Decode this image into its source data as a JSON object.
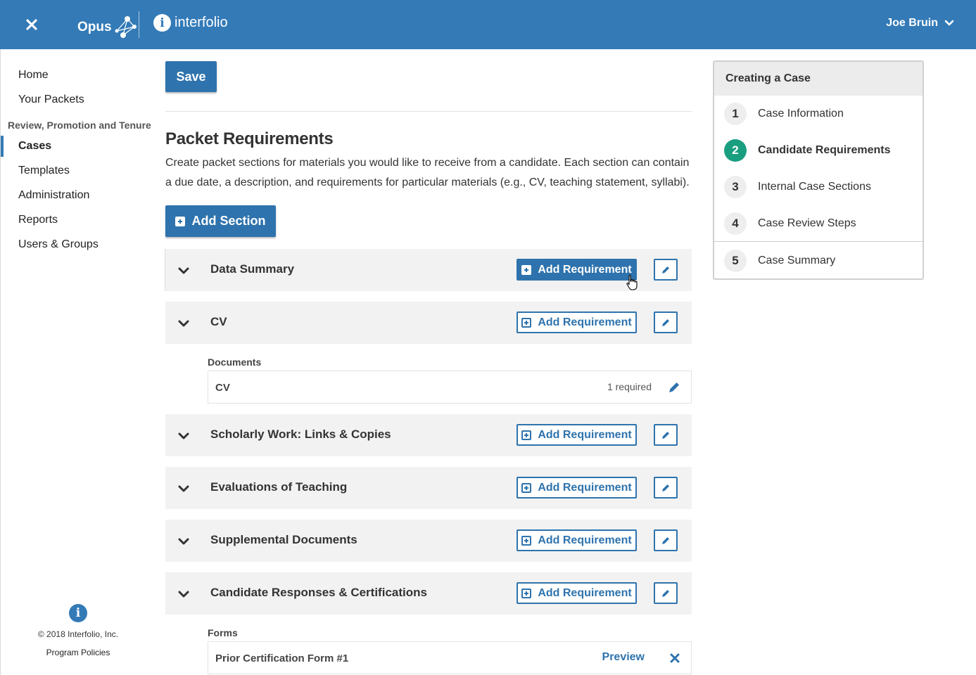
{
  "topbar": {
    "close_icon": "close-icon",
    "opus_label": "Opus",
    "interfolio_label": "interfolio",
    "info_glyph": "i",
    "user_name": "Joe Bruin",
    "brand_color": "#337ab7"
  },
  "sidebar": {
    "items": [
      {
        "label": "Home"
      },
      {
        "label": "Your Packets"
      },
      {
        "label": "Cases"
      },
      {
        "label": "Templates"
      },
      {
        "label": "Administration"
      },
      {
        "label": "Reports"
      },
      {
        "label": "Users & Groups"
      }
    ],
    "section_label": "Review, Promotion and Tenure",
    "active_item": "Cases",
    "footer": {
      "info_glyph": "i",
      "copyright": "© 2018 Interfolio, Inc.",
      "policies": "Program Policies"
    }
  },
  "main": {
    "save_label": "Save",
    "title": "Packet Requirements",
    "description": "Create packet sections for materials you would like to receive from a candidate. Each section can contain a due date, a description, and requirements for particular materials (e.g., CV, teaching statement, syllabi).",
    "add_section_label": "Add Section",
    "add_requirement_label": "Add Requirement",
    "sections": [
      {
        "title": "Data Summary"
      },
      {
        "title": "CV"
      },
      {
        "title": "Scholarly Work: Links & Copies"
      },
      {
        "title": "Evaluations of Teaching"
      },
      {
        "title": "Supplemental Documents"
      },
      {
        "title": "Candidate Responses & Certifications"
      }
    ],
    "cv_documents": {
      "label": "Documents",
      "items": [
        {
          "name": "CV",
          "requirement": "1 required"
        }
      ]
    },
    "candidate_forms": {
      "label": "Forms",
      "items": [
        {
          "name": "Prior Certification Form #1",
          "preview_label": "Preview"
        }
      ]
    }
  },
  "steps_panel": {
    "title": "Creating a Case",
    "steps": [
      {
        "num": "1",
        "label": "Case Information"
      },
      {
        "num": "2",
        "label": "Candidate Requirements"
      },
      {
        "num": "3",
        "label": "Internal Case Sections"
      },
      {
        "num": "4",
        "label": "Case Review Steps"
      },
      {
        "num": "5",
        "label": "Case Summary"
      }
    ],
    "active_step": "2",
    "active_color": "#1a9e80"
  }
}
